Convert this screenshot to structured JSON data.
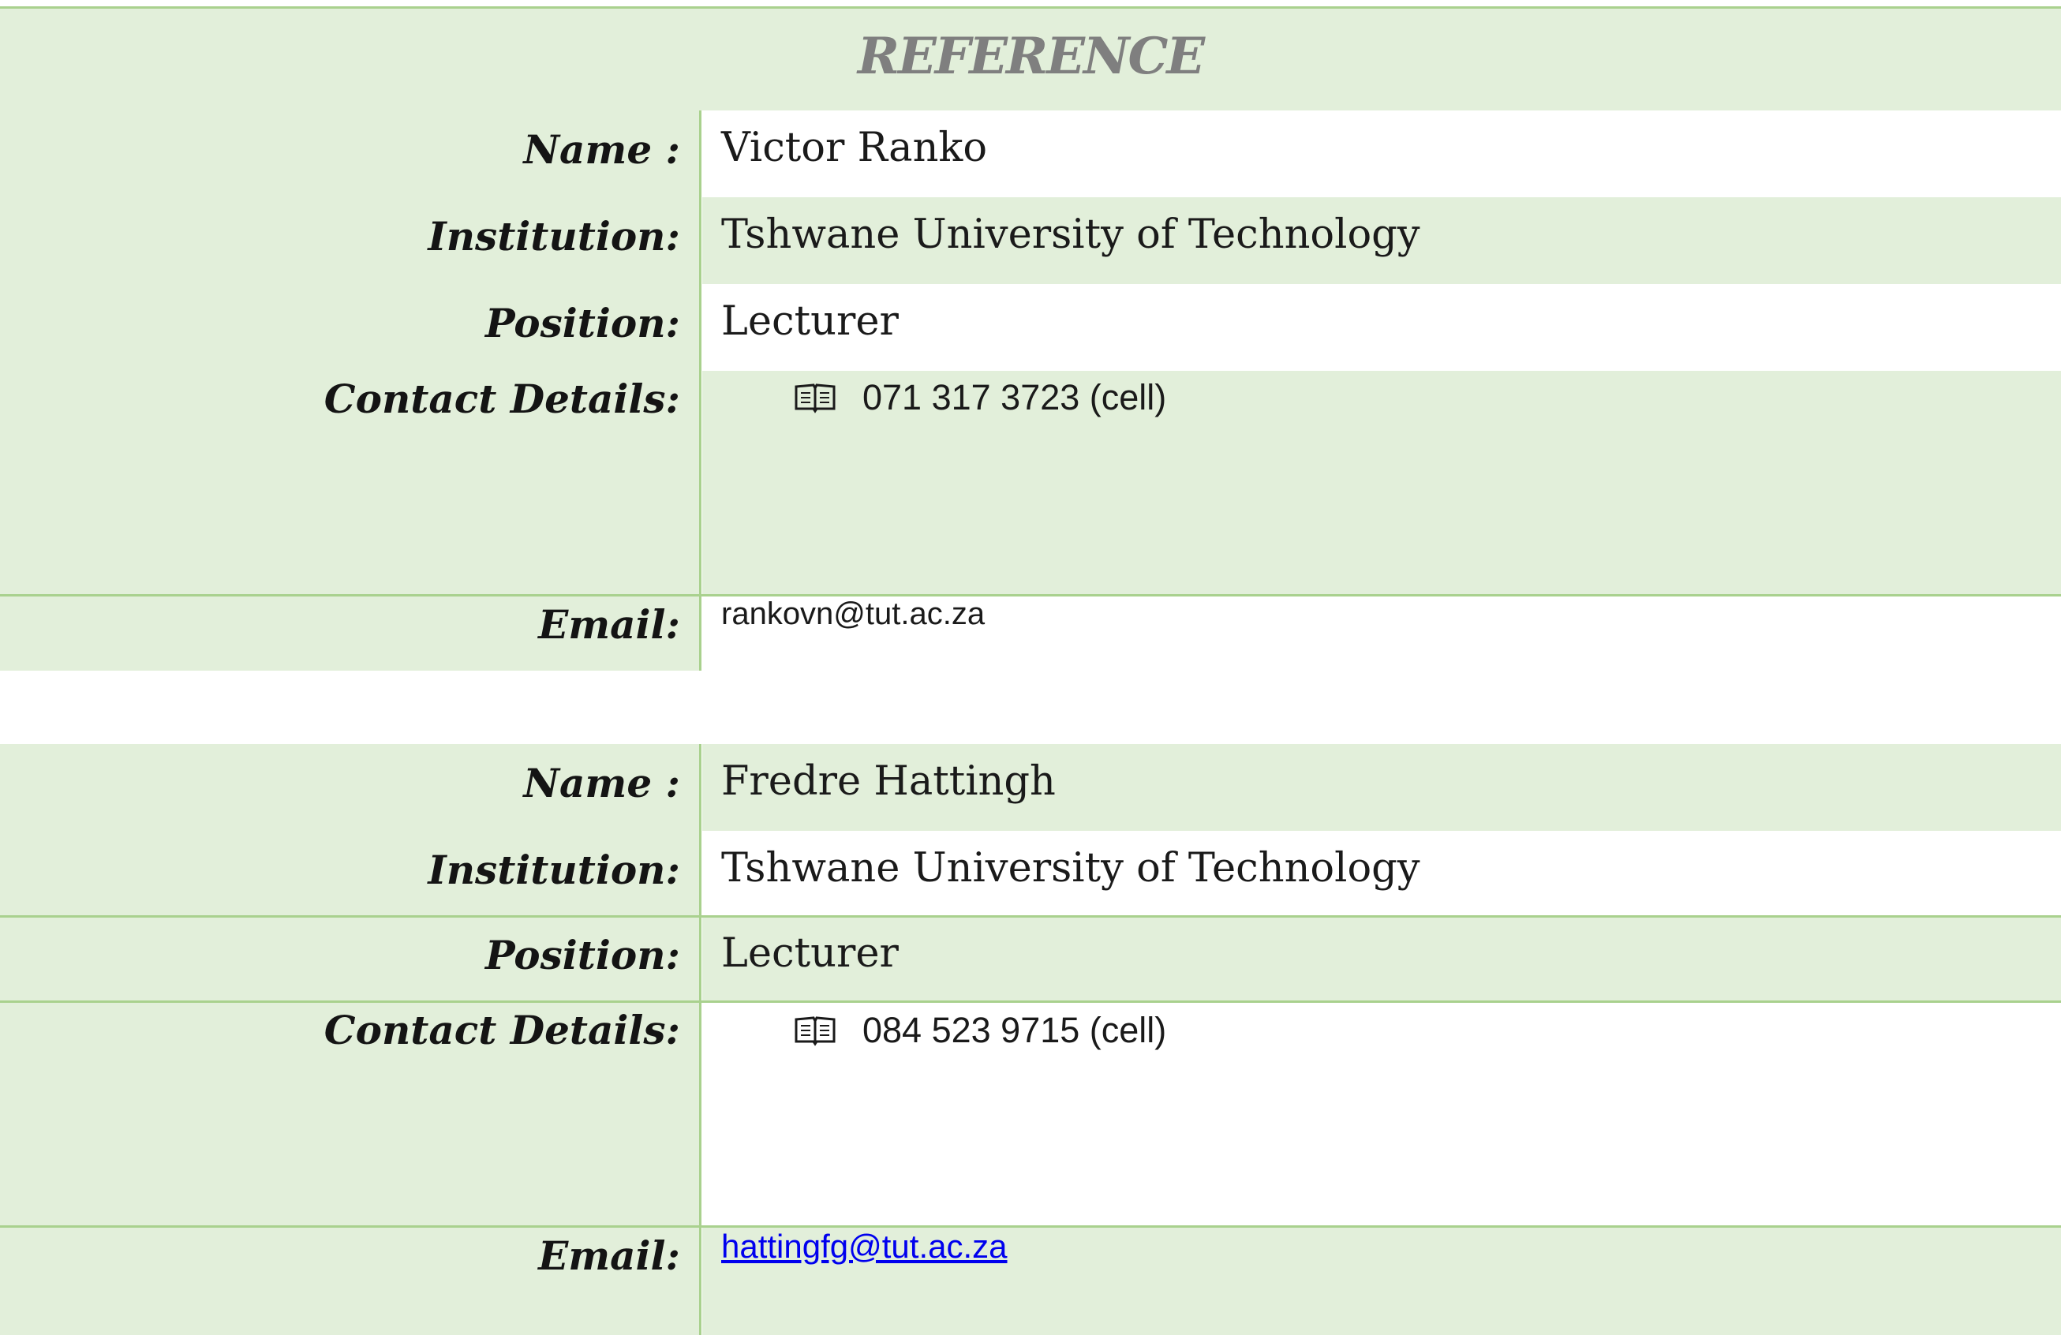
{
  "title": "REFERENCE",
  "references": [
    {
      "name_label": "Name :",
      "name": "Victor Ranko",
      "institution_label": "Institution:",
      "institution": "Tshwane University of Technology",
      "position_label": "Position:",
      "position": "Lecturer",
      "contact_label": "Contact Details:",
      "contact_icon": "phone-book-icon",
      "contact": "071 317 3723 (cell)",
      "email_label": "Email:",
      "email": "rankovn@tut.ac.za"
    },
    {
      "name_label": "Name :",
      "name": "Fredre Hattingh",
      "institution_label": "Institution:",
      "institution": "Tshwane University of Technology",
      "position_label": "Position:",
      "position": "Lecturer",
      "contact_label": "Contact Details:",
      "contact_icon": "phone-book-icon",
      "contact": "084 523 9715 (cell)",
      "email_label": "Email:",
      "email": "hattingfg@tut.ac.za"
    }
  ],
  "colors": {
    "band_green": "#e2efda",
    "border_green": "#a9d18e",
    "title_gray": "#7f7f7f",
    "link_blue": "#0000ee"
  }
}
